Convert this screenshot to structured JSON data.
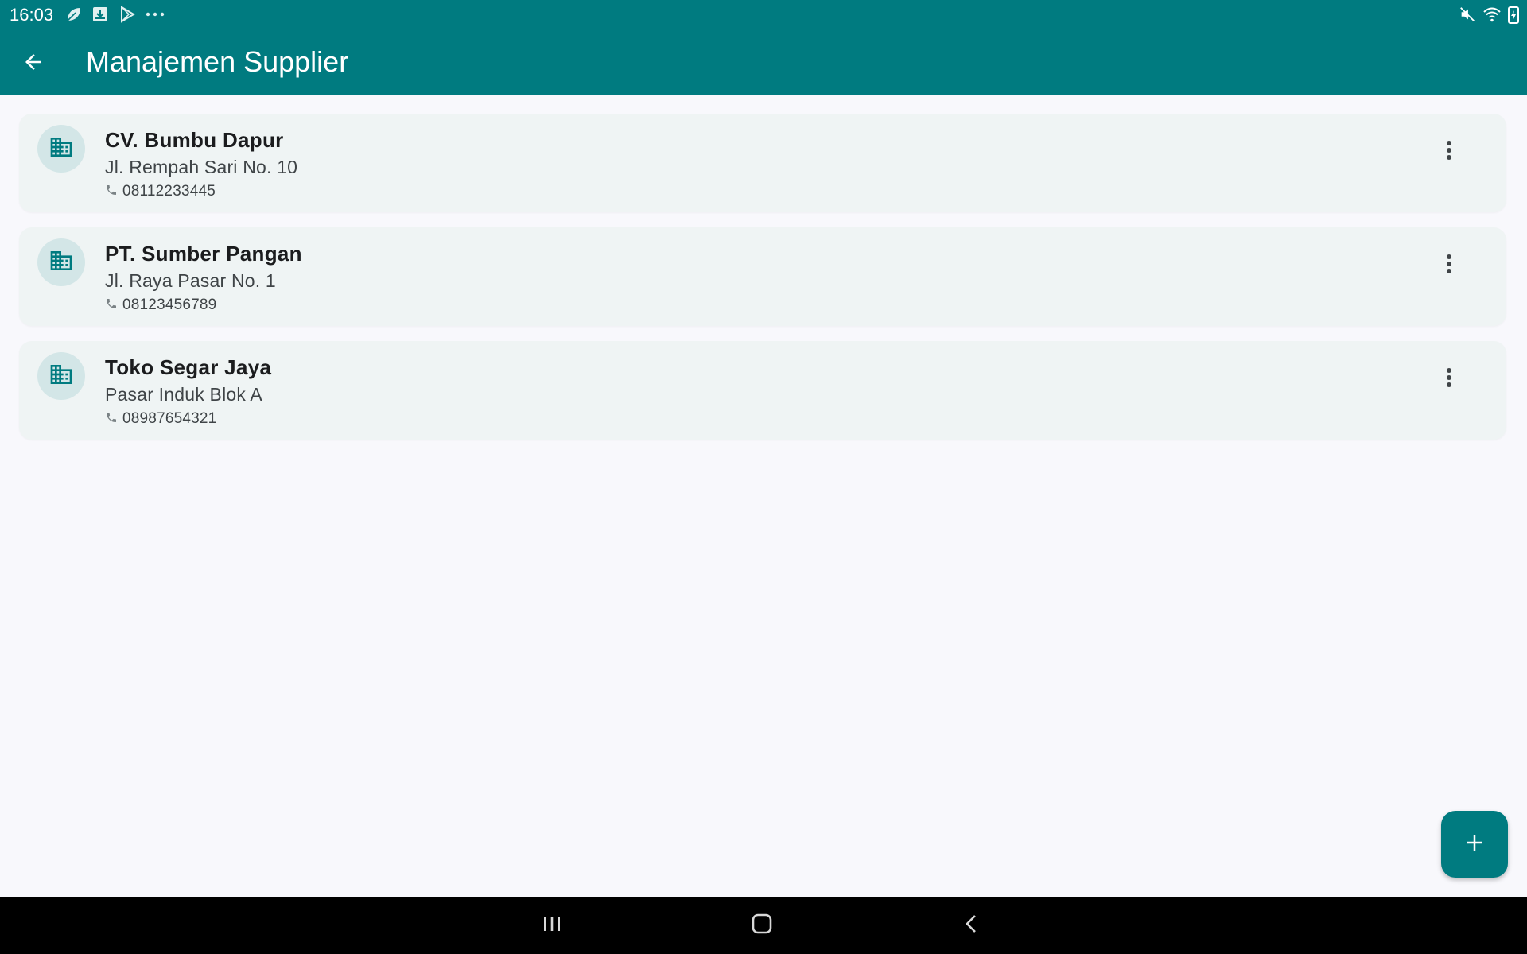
{
  "status_bar": {
    "time": "16:03",
    "left_icons": [
      "leaf-icon",
      "download-box-icon",
      "play-store-icon",
      "more-dots-icon"
    ],
    "right_icons": [
      "mute-icon",
      "wifi-icon",
      "battery-icon"
    ]
  },
  "app_bar": {
    "title": "Manajemen Supplier",
    "back_icon": "arrow-left-icon"
  },
  "colors": {
    "primary": "#007b80",
    "card_background": "#eff4f4",
    "avatar_background": "#d3e6e7",
    "page_background": "#f8f8fc"
  },
  "suppliers": [
    {
      "name": "CV. Bumbu Dapur",
      "address": "Jl. Rempah Sari No. 10",
      "phone": "08112233445"
    },
    {
      "name": "PT. Sumber Pangan",
      "address": "Jl. Raya Pasar No. 1",
      "phone": "08123456789"
    },
    {
      "name": "Toko Segar Jaya",
      "address": "Pasar Induk Blok A",
      "phone": "08987654321"
    }
  ],
  "fab": {
    "icon": "plus-icon"
  },
  "nav_bar": {
    "buttons": [
      "recent-apps-icon",
      "home-icon",
      "back-icon"
    ]
  }
}
